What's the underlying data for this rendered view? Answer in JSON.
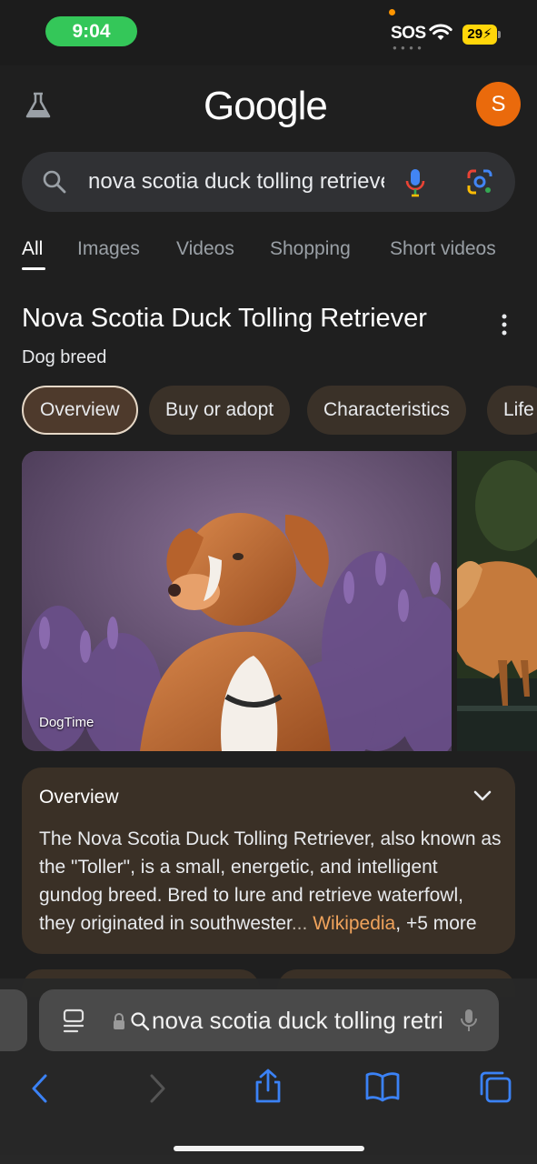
{
  "status_bar": {
    "time": "9:04",
    "carrier": "SOS",
    "signal_dots": "● ● ● ●",
    "battery": "29",
    "battery_icon": "charging-bolt",
    "colors": {
      "time_pill": "#34c759",
      "battery": "#ffd60a"
    }
  },
  "header": {
    "logo": "Google",
    "avatar_letter": "S",
    "avatar_color": "#ea6a0c"
  },
  "search": {
    "query": "nova scotia duck tolling retriever"
  },
  "tabs": [
    {
      "label": "All",
      "active": true
    },
    {
      "label": "Images",
      "active": false
    },
    {
      "label": "Videos",
      "active": false
    },
    {
      "label": "Shopping",
      "active": false
    },
    {
      "label": "Short videos",
      "active": false
    }
  ],
  "knowledge_panel": {
    "title": "Nova Scotia Duck Tolling Retriever",
    "subtitle": "Dog breed",
    "chips": [
      {
        "label": "Overview",
        "active": true
      },
      {
        "label": "Buy or adopt",
        "active": false
      },
      {
        "label": "Characteristics",
        "active": false
      },
      {
        "label": "Life",
        "active": false
      }
    ],
    "image_source": "DogTime"
  },
  "overview": {
    "heading": "Overview",
    "text": "The Nova Scotia Duck Tolling Retriever, also known as the \"Toller\", is a small, energetic, and intelligent gundog breed. Bred to lure and retrieve waterfowl, they originated in southwester",
    "ellipsis": "...",
    "source_link": "Wikipedia",
    "separator": ",",
    "more_link": "+5 more"
  },
  "safari": {
    "url_text": "nova scotia duck tolling retriever",
    "icons": [
      "reader-icon",
      "lock-icon",
      "search-icon",
      "mic-icon",
      "back-icon",
      "forward-icon",
      "share-icon",
      "bookmarks-icon",
      "tabs-icon"
    ]
  }
}
